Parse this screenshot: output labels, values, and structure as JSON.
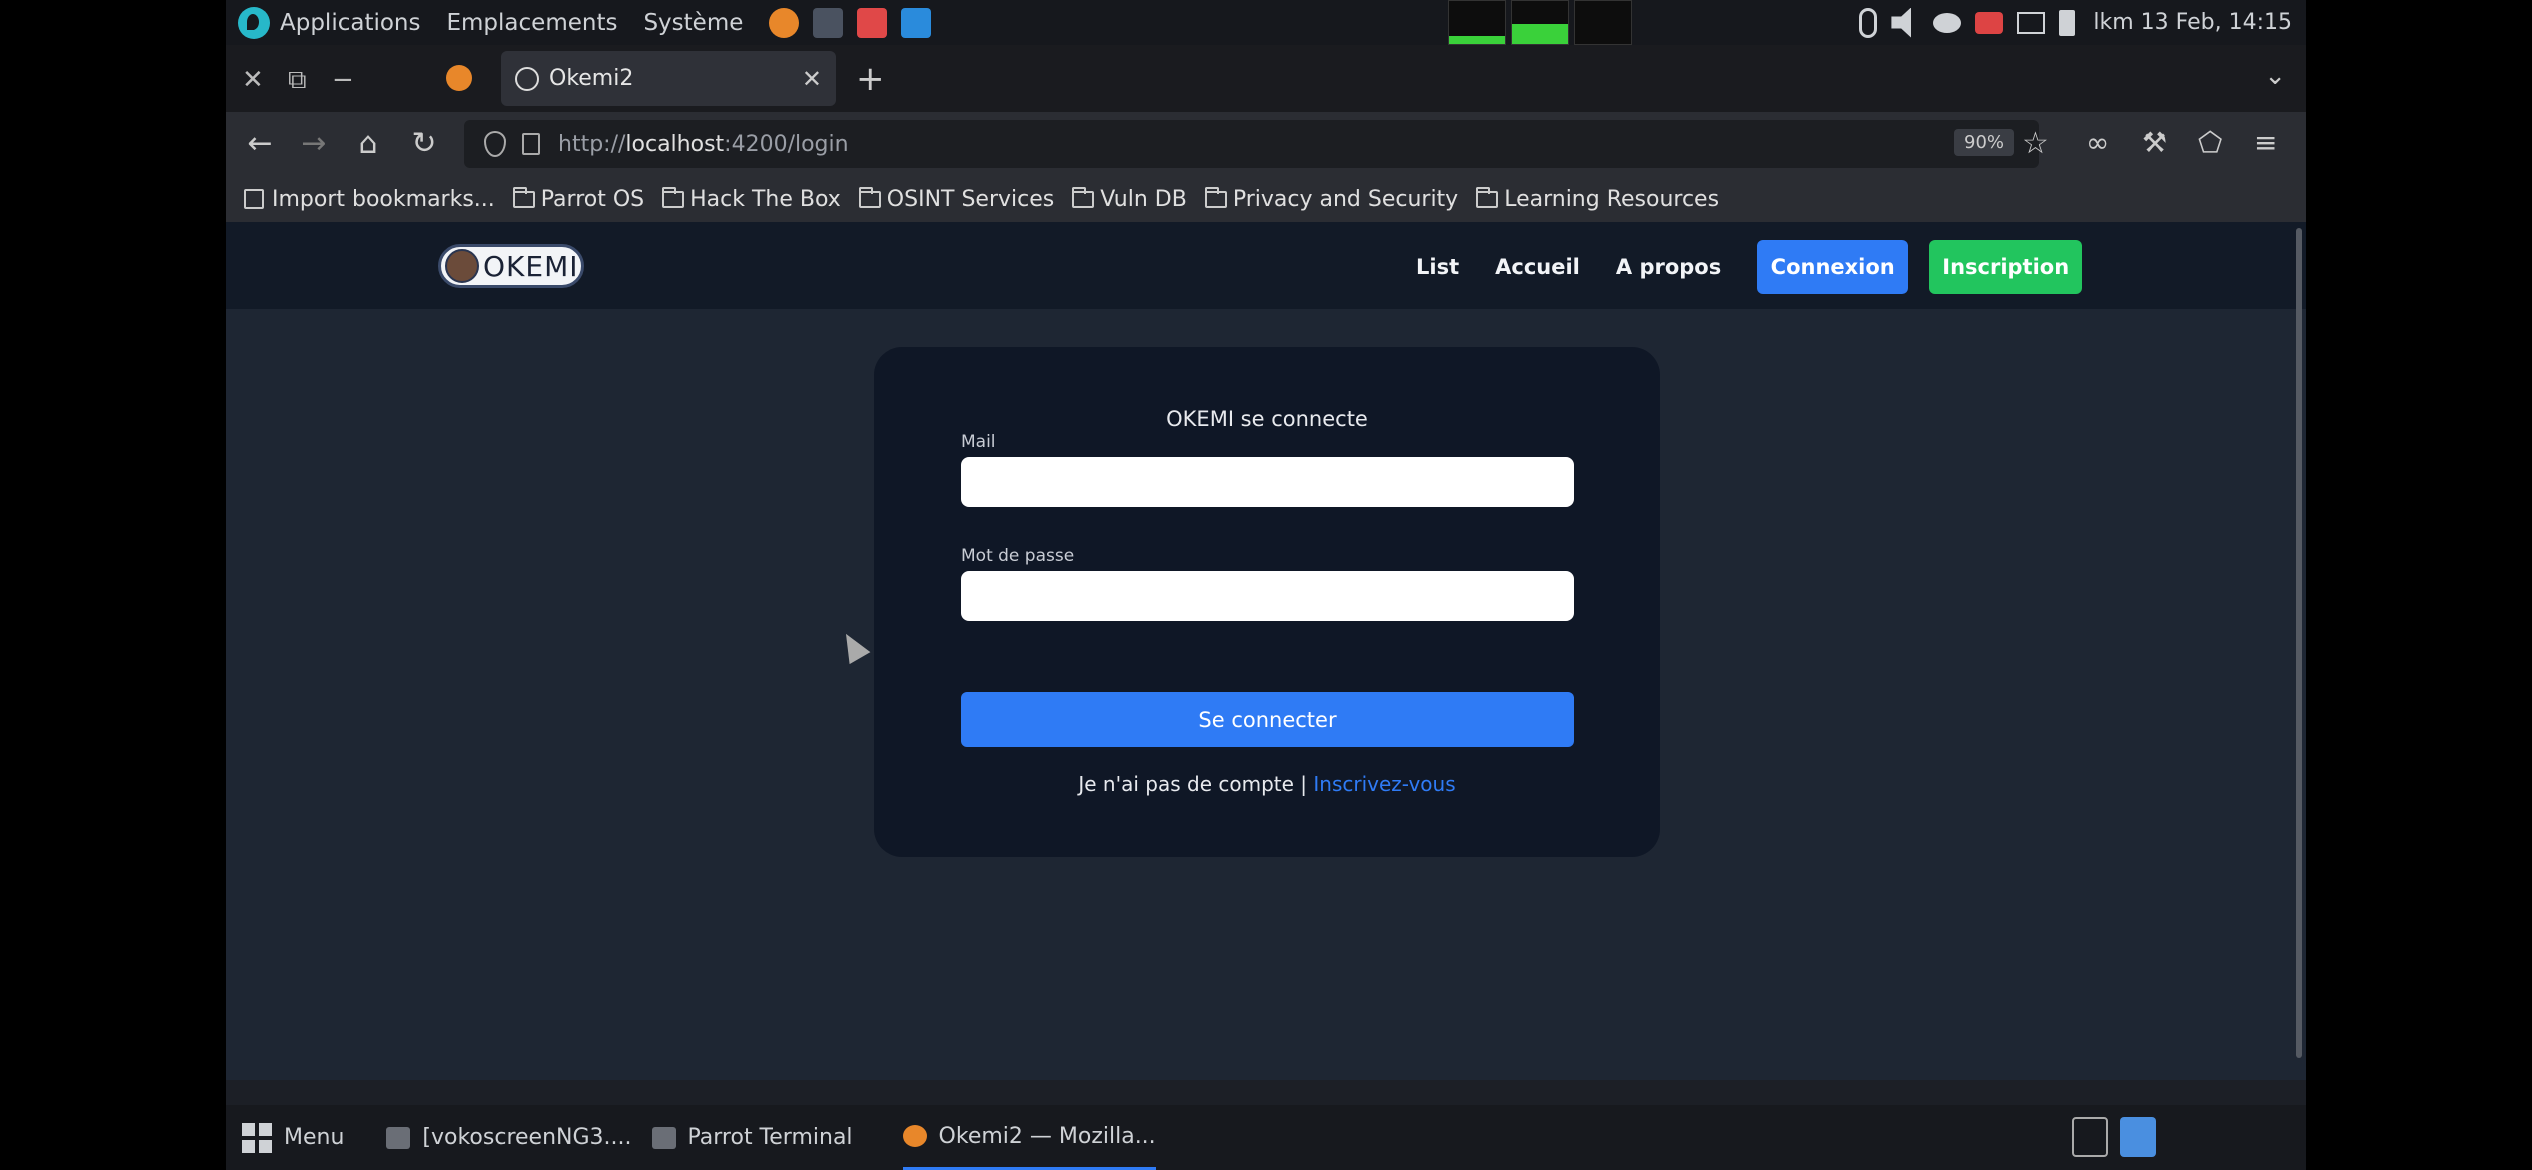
{
  "system_panel": {
    "menus": [
      "Applications",
      "Emplacements",
      "Système"
    ],
    "clock": "lkm 13 Feb, 14:15"
  },
  "browser": {
    "tab_title": "Okemi2",
    "url_prefix": "http://",
    "url_host": "localhost",
    "url_rest": ":4200/login",
    "zoom": "90%",
    "bookmarks": [
      "Import bookmarks...",
      "Parrot OS",
      "Hack The Box",
      "OSINT Services",
      "Vuln DB",
      "Privacy and Security",
      "Learning Resources"
    ]
  },
  "site": {
    "logo_text": "OKEMI",
    "nav": {
      "list": "List",
      "accueil": "Accueil",
      "apropos": "A propos",
      "connexion": "Connexion",
      "inscription": "Inscription"
    },
    "login": {
      "title": "OKEMI se connecte",
      "mail_label": "Mail",
      "password_label": "Mot de passe",
      "submit": "Se connecter",
      "no_account": "Je n'ai pas de compte |",
      "signup_link": "Inscrivez-vous"
    }
  },
  "taskbar": {
    "menu": "Menu",
    "tasks": [
      "[vokoscreenNG3....",
      "Parrot Terminal",
      "Okemi2 — Mozilla..."
    ]
  },
  "colors": {
    "accent_blue": "#2f7bf5",
    "accent_green": "#22c55e",
    "page_bg": "#1e2633",
    "card_bg": "#0f1726"
  }
}
